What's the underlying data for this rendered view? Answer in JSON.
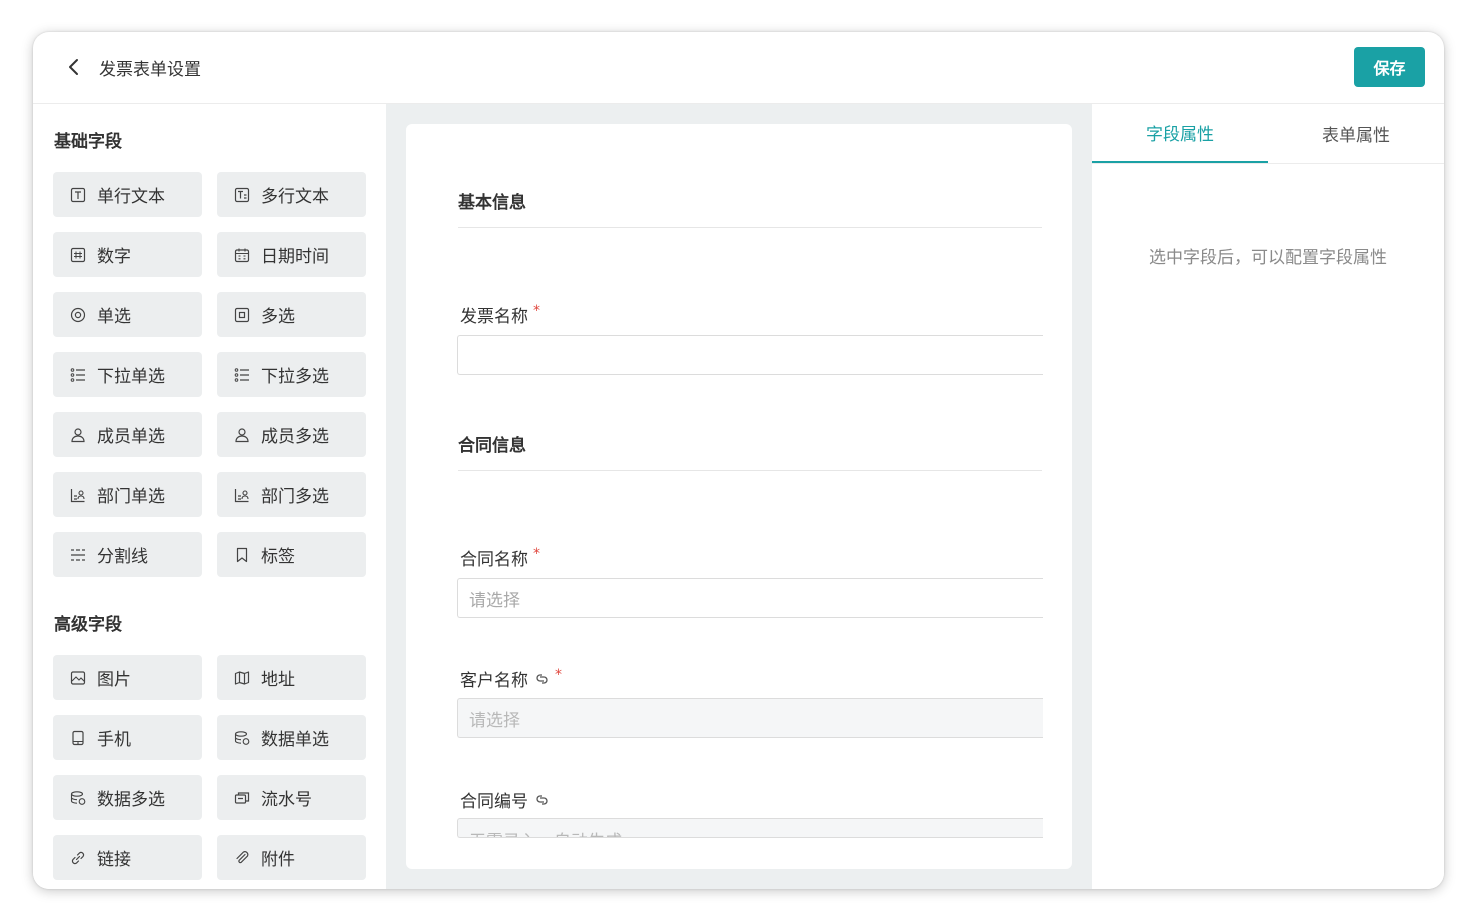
{
  "header": {
    "title": "发票表单设置",
    "save_label": "保存"
  },
  "palette": {
    "basic_title": "基础字段",
    "basic_fields": [
      {
        "label": "单行文本",
        "icon": "single-line-text-icon"
      },
      {
        "label": "多行文本",
        "icon": "multi-line-text-icon"
      },
      {
        "label": "数字",
        "icon": "number-icon"
      },
      {
        "label": "日期时间",
        "icon": "calendar-icon"
      },
      {
        "label": "单选",
        "icon": "radio-icon"
      },
      {
        "label": "多选",
        "icon": "checkbox-icon"
      },
      {
        "label": "下拉单选",
        "icon": "list-icon"
      },
      {
        "label": "下拉多选",
        "icon": "list-icon"
      },
      {
        "label": "成员单选",
        "icon": "user-icon"
      },
      {
        "label": "成员多选",
        "icon": "user-icon"
      },
      {
        "label": "部门单选",
        "icon": "department-icon"
      },
      {
        "label": "部门多选",
        "icon": "department-icon"
      },
      {
        "label": "分割线",
        "icon": "divider-icon"
      },
      {
        "label": "标签",
        "icon": "bookmark-icon"
      }
    ],
    "advanced_title": "高级字段",
    "advanced_fields": [
      {
        "label": "图片",
        "icon": "image-icon"
      },
      {
        "label": "地址",
        "icon": "map-icon"
      },
      {
        "label": "手机",
        "icon": "phone-icon"
      },
      {
        "label": "数据单选",
        "icon": "database-icon"
      },
      {
        "label": "数据多选",
        "icon": "database-icon"
      },
      {
        "label": "流水号",
        "icon": "serial-number-icon"
      },
      {
        "label": "链接",
        "icon": "link-icon"
      },
      {
        "label": "附件",
        "icon": "attachment-icon"
      }
    ]
  },
  "form": {
    "section_basic": "基本信息",
    "invoice_name_label": "发票名称",
    "required_mark": "*",
    "section_contract": "合同信息",
    "contract_name_label": "合同名称",
    "contract_name_placeholder": "请选择",
    "customer_name_label": "客户名称",
    "customer_name_placeholder": "请选择",
    "contract_no_label": "合同编号",
    "contract_no_placeholder": "无需录入，自动生成"
  },
  "props": {
    "tabs": [
      "字段属性",
      "表单属性"
    ],
    "hint": "选中字段后，可以配置字段属性"
  },
  "colors": {
    "accent": "#1aa1a5",
    "required": "#e0463d"
  }
}
